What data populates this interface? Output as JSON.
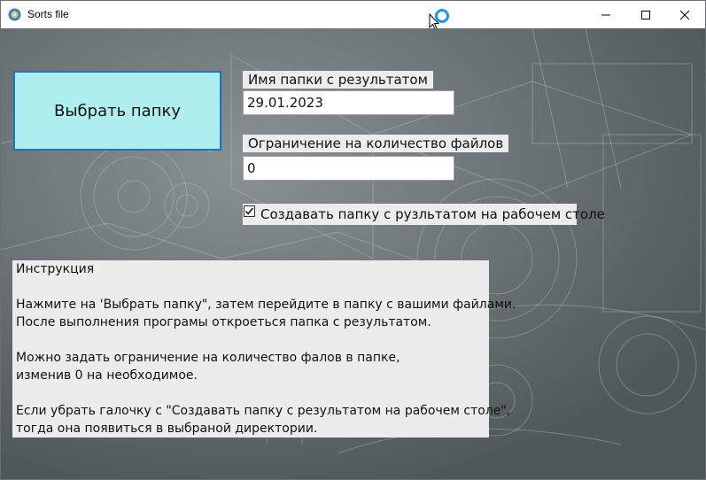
{
  "window": {
    "title": "Sorts file",
    "icon": "app-icon",
    "controls": [
      "minimize-icon",
      "maximize-icon",
      "close-icon"
    ]
  },
  "main": {
    "pick_button_label": "Выбрать папку",
    "folder_name_label": "Имя папки с результатом",
    "folder_name_value": "29.01.2023",
    "limit_label": "Ограничение на количество файлов",
    "limit_value": "0",
    "desktop_checkbox_label": "Создавать папку с рузльтатом на рабочем столе",
    "desktop_checkbox_checked": true
  },
  "instructions": {
    "lines": [
      "Инструкция",
      "",
      "Нажмите на 'Выбрать папку\", затем перейдите в папку с вашими файлами.",
      "После выполнения програмы откроеться папка с результатом.",
      "",
      "Можно задать ограничение на количество фалов в папке,",
      "изменив 0 на необходимое.",
      "",
      "Если убрать галочку с  \"Создавать папку с результатом на рабочем столе\",",
      "тогда она появиться в выбраной директории."
    ]
  },
  "colors": {
    "button_bg": "#afeeee",
    "button_border": "#1f73c6",
    "label_bg": "#ececec",
    "background": "#6a7276"
  }
}
